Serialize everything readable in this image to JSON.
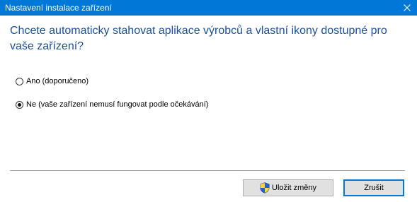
{
  "window": {
    "title": "Nastavení instalace zařízení",
    "close_glyph": "✕"
  },
  "question": "Chcete automaticky stahovat aplikace výrobců a vlastní ikony dostupné pro vaše zařízení?",
  "options": [
    {
      "label": "Ano (doporučeno)",
      "selected": false
    },
    {
      "label": "Ne (vaše zařízení nemusí fungovat podle očekávání)",
      "selected": true
    }
  ],
  "buttons": {
    "save_label": "Uložit změny",
    "save_icon": "uac-shield-icon",
    "cancel_label": "Zrušit"
  },
  "colors": {
    "titlebar": "#0078d7",
    "heading_text": "#1b4f9a",
    "default_button_border": "#0078d7"
  }
}
